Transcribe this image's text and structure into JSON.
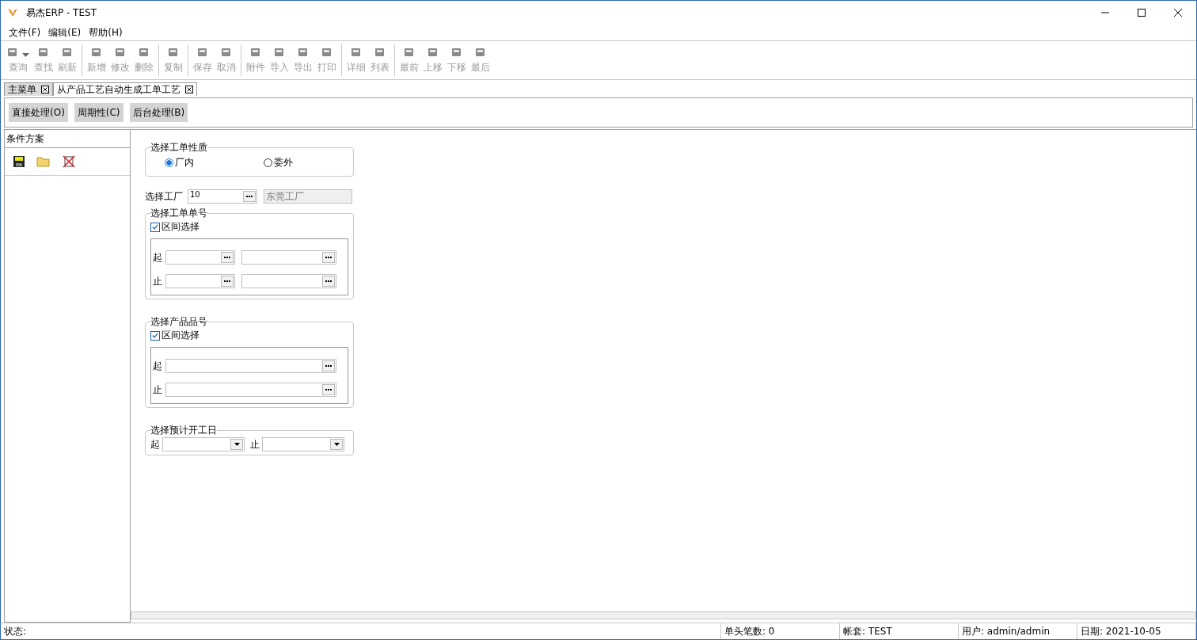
{
  "window": {
    "title": "易杰ERP - TEST"
  },
  "menu": [
    {
      "label": "文件(F)"
    },
    {
      "label": "编辑(E)"
    },
    {
      "label": "帮助(H)"
    }
  ],
  "toolbar": [
    [
      {
        "label": "查询",
        "disabled": true,
        "dropdown": true
      },
      {
        "label": "查找",
        "disabled": true,
        "dropdown": false
      },
      {
        "label": "刷新",
        "disabled": true,
        "dropdown": false
      }
    ],
    [
      {
        "label": "新增",
        "disabled": true,
        "dropdown": false
      },
      {
        "label": "修改",
        "disabled": true,
        "dropdown": false
      },
      {
        "label": "删除",
        "disabled": true,
        "dropdown": false
      }
    ],
    [
      {
        "label": "复制",
        "disabled": true,
        "dropdown": false
      }
    ],
    [
      {
        "label": "保存",
        "disabled": true,
        "dropdown": false
      },
      {
        "label": "取消",
        "disabled": true,
        "dropdown": false
      }
    ],
    [
      {
        "label": "附件",
        "disabled": true,
        "dropdown": false
      },
      {
        "label": "导入",
        "disabled": true,
        "dropdown": false
      },
      {
        "label": "导出",
        "disabled": true,
        "dropdown": false
      },
      {
        "label": "打印",
        "disabled": true,
        "dropdown": false
      }
    ],
    [
      {
        "label": "详细",
        "disabled": true,
        "dropdown": false
      },
      {
        "label": "列表",
        "disabled": true,
        "dropdown": false
      }
    ],
    [
      {
        "label": "最前",
        "disabled": true,
        "dropdown": false
      },
      {
        "label": "上移",
        "disabled": true,
        "dropdown": false
      },
      {
        "label": "下移",
        "disabled": true,
        "dropdown": false
      },
      {
        "label": "最后",
        "disabled": true,
        "dropdown": false
      }
    ]
  ],
  "tabs": [
    {
      "label": "主菜单",
      "selected": false
    },
    {
      "label": "从产品工艺自动生成工单工艺",
      "selected": true
    }
  ],
  "process_buttons": [
    {
      "label": "直接处理(O)"
    },
    {
      "label": "周期性(C)"
    },
    {
      "label": "后台处理(B)"
    }
  ],
  "sidebar": {
    "title": "条件方案"
  },
  "form": {
    "order_type": {
      "legend": "选择工单性质",
      "options": [
        {
          "label": "厂内",
          "selected": true
        },
        {
          "label": "委外",
          "selected": false
        }
      ]
    },
    "factory": {
      "label": "选择工厂",
      "value": "10",
      "name": "东莞工厂"
    },
    "order_no": {
      "legend": "选择工单单号",
      "range_label": "区间选择",
      "range_checked": true,
      "from_label": "起",
      "to_label": "止"
    },
    "product_no": {
      "legend": "选择产品品号",
      "range_label": "区间选择",
      "range_checked": true,
      "from_label": "起",
      "to_label": "止"
    },
    "start_date": {
      "legend": "选择预计开工日",
      "from_label": "起",
      "to_label": "止"
    }
  },
  "status_bar": {
    "status": "状态:",
    "count": "单头笔数: 0",
    "account": "帐套: TEST",
    "user": "用户: admin/admin",
    "date": "日期: 2021-10-05"
  }
}
